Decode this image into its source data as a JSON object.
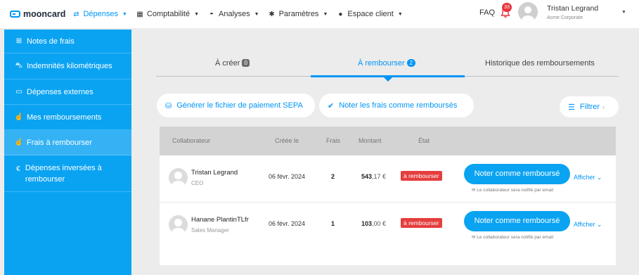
{
  "topnav": {
    "brand": "mooncard",
    "items": [
      {
        "label": "Dépenses",
        "icon": "exchange-icon",
        "active": true
      },
      {
        "label": "Comptabilité",
        "icon": "ledger-icon",
        "active": false
      },
      {
        "label": "Analyses",
        "icon": "gauge-icon",
        "active": false
      },
      {
        "label": "Paramètres",
        "icon": "gear-icon",
        "active": false
      },
      {
        "label": "Espace client",
        "icon": "user-icon",
        "active": false
      }
    ],
    "faq": "FAQ",
    "notifications": "33",
    "user_name": "Tristan Legrand",
    "user_org": "Acme Corporate"
  },
  "sidebar": {
    "items": [
      {
        "label": "Notes de frais",
        "icon": "receipt-icon"
      },
      {
        "label": "Indemnités kilométriques",
        "icon": "car-icon"
      },
      {
        "label": "Dépenses externes",
        "icon": "card-icon"
      },
      {
        "label": "Mes remboursements",
        "icon": "hand-coin-icon"
      },
      {
        "label": "Frais à rembourser",
        "icon": "hand-coin-icon",
        "active": true
      },
      {
        "label": "Dépenses inversées à rembourser",
        "icon": "euro-refund-icon"
      }
    ]
  },
  "tabs": [
    {
      "label": "À créer",
      "count": "0"
    },
    {
      "label": "À rembourser",
      "count": "2",
      "active": true
    },
    {
      "label": "Historique des remboursements"
    }
  ],
  "actions": {
    "sepa": "Générer le fichier de paiement SEPA",
    "mark_reimbursed": "Noter les frais comme remboursés",
    "filter": "Filtrer"
  },
  "table": {
    "headers": {
      "collaborator": "Collaborateur",
      "created": "Créée le",
      "expenses": "Frais",
      "amount": "Montant",
      "state": "État"
    },
    "rows": [
      {
        "name": "Tristan Legrand",
        "role": "CEO",
        "date": "06 févr. 2024",
        "count": "2",
        "amount_int": "543",
        "amount_dec": ",17 €",
        "state": "à rembourser",
        "button": "Noter comme remboursé",
        "note": "Le collaborateur sera notifié par email",
        "show": "Afficher"
      },
      {
        "name": "Hanane PlantinTLfr",
        "role": "Sales Manager",
        "date": "06 févr. 2024",
        "count": "1",
        "amount_int": "103",
        "amount_dec": ",00 €",
        "state": "à rembourser",
        "button": "Noter comme remboursé",
        "note": "Le collaborateur sera notifié par email",
        "show": "Afficher"
      }
    ]
  },
  "colors": {
    "accent": "#0095f6",
    "sidebar": "#0aa3f2",
    "danger": "#e53e3e"
  }
}
